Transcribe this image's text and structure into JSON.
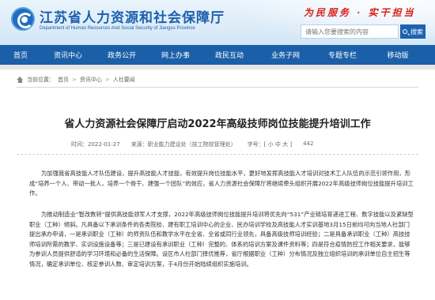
{
  "header": {
    "title": "江苏省人力资源和社会保障厅",
    "subtitle": "Department of Human Resources And Social Security of Jiangsu Province",
    "slogan": "为民服务 · 实干担当",
    "search_placeholder": "请输入您要搜索的内容",
    "search_button": "搜索"
  },
  "nav": {
    "items": [
      "首页",
      "资讯中心",
      "政务公开",
      "网上办事",
      "政民互动",
      "业务子网",
      "专题专栏",
      "移动版"
    ]
  },
  "breadcrumb": {
    "label": "当前位置：",
    "items": [
      "首页",
      "资讯中心",
      "人社要闻"
    ]
  },
  "article": {
    "title": "省人力资源社会保障厅启动2022年高级技师岗位技能提升培训工作",
    "date": "时间：2022-01-27",
    "source": "来源：职业能力建设处（技工院校管理处）",
    "font_size": "字号：[ 小  中  大 ]",
    "views": "442",
    "paragraphs": [
      "为加强我省高技能人才队伍建设，提升高技能人才技能，有效提升岗位技能水平，更好地发挥高技能人才培训对技术工人队伍的示范引领作用，形成“培养一个人、带动一批人，培养一个骨干、建强一个团队”的效应，省人力资源社会保障厅将继续牵头组织开展2022年高级技师岗位技能提升培训工作。",
      "为推动制造业“智改数转”提供高技能领军人才支撑，2022年高级技师岗位技能提升培训将优先向“531”产业链培育递进工程、数字技能以及紧缺型职业（工种）倾斜。凡具备以下承训条件的各类院校、建有职工培训中心的企业、民办培训学校及高技能人才实训基地3月15日前均可向当地人社部门提出承办申请，一是承训职业（工种）的师资队伍和教学水平在全省、全省或同行业领先，具备高级技师培训经验；二是具备承训职业（工种）高技技师培训所需的教学、实训设施设备等；三是已建设有承训职业（工种）完整的、体系的培训方案及课件资料等；四是符合疫情防控工作相关要求，能够为参训人员提供舒适的学习环境和必备的生活保障。设区市人社部门择优推荐，省厅根据职业（工种）分布情况及独立组织培训的承训单位自主招生等情况，确定承训单位、核定参训人数、审定培训方案，于4月份开始陆续组织实施培训。"
    ]
  },
  "colors": {
    "brand_blue": "#1b5fa8",
    "slogan_red": "#d8201c"
  }
}
